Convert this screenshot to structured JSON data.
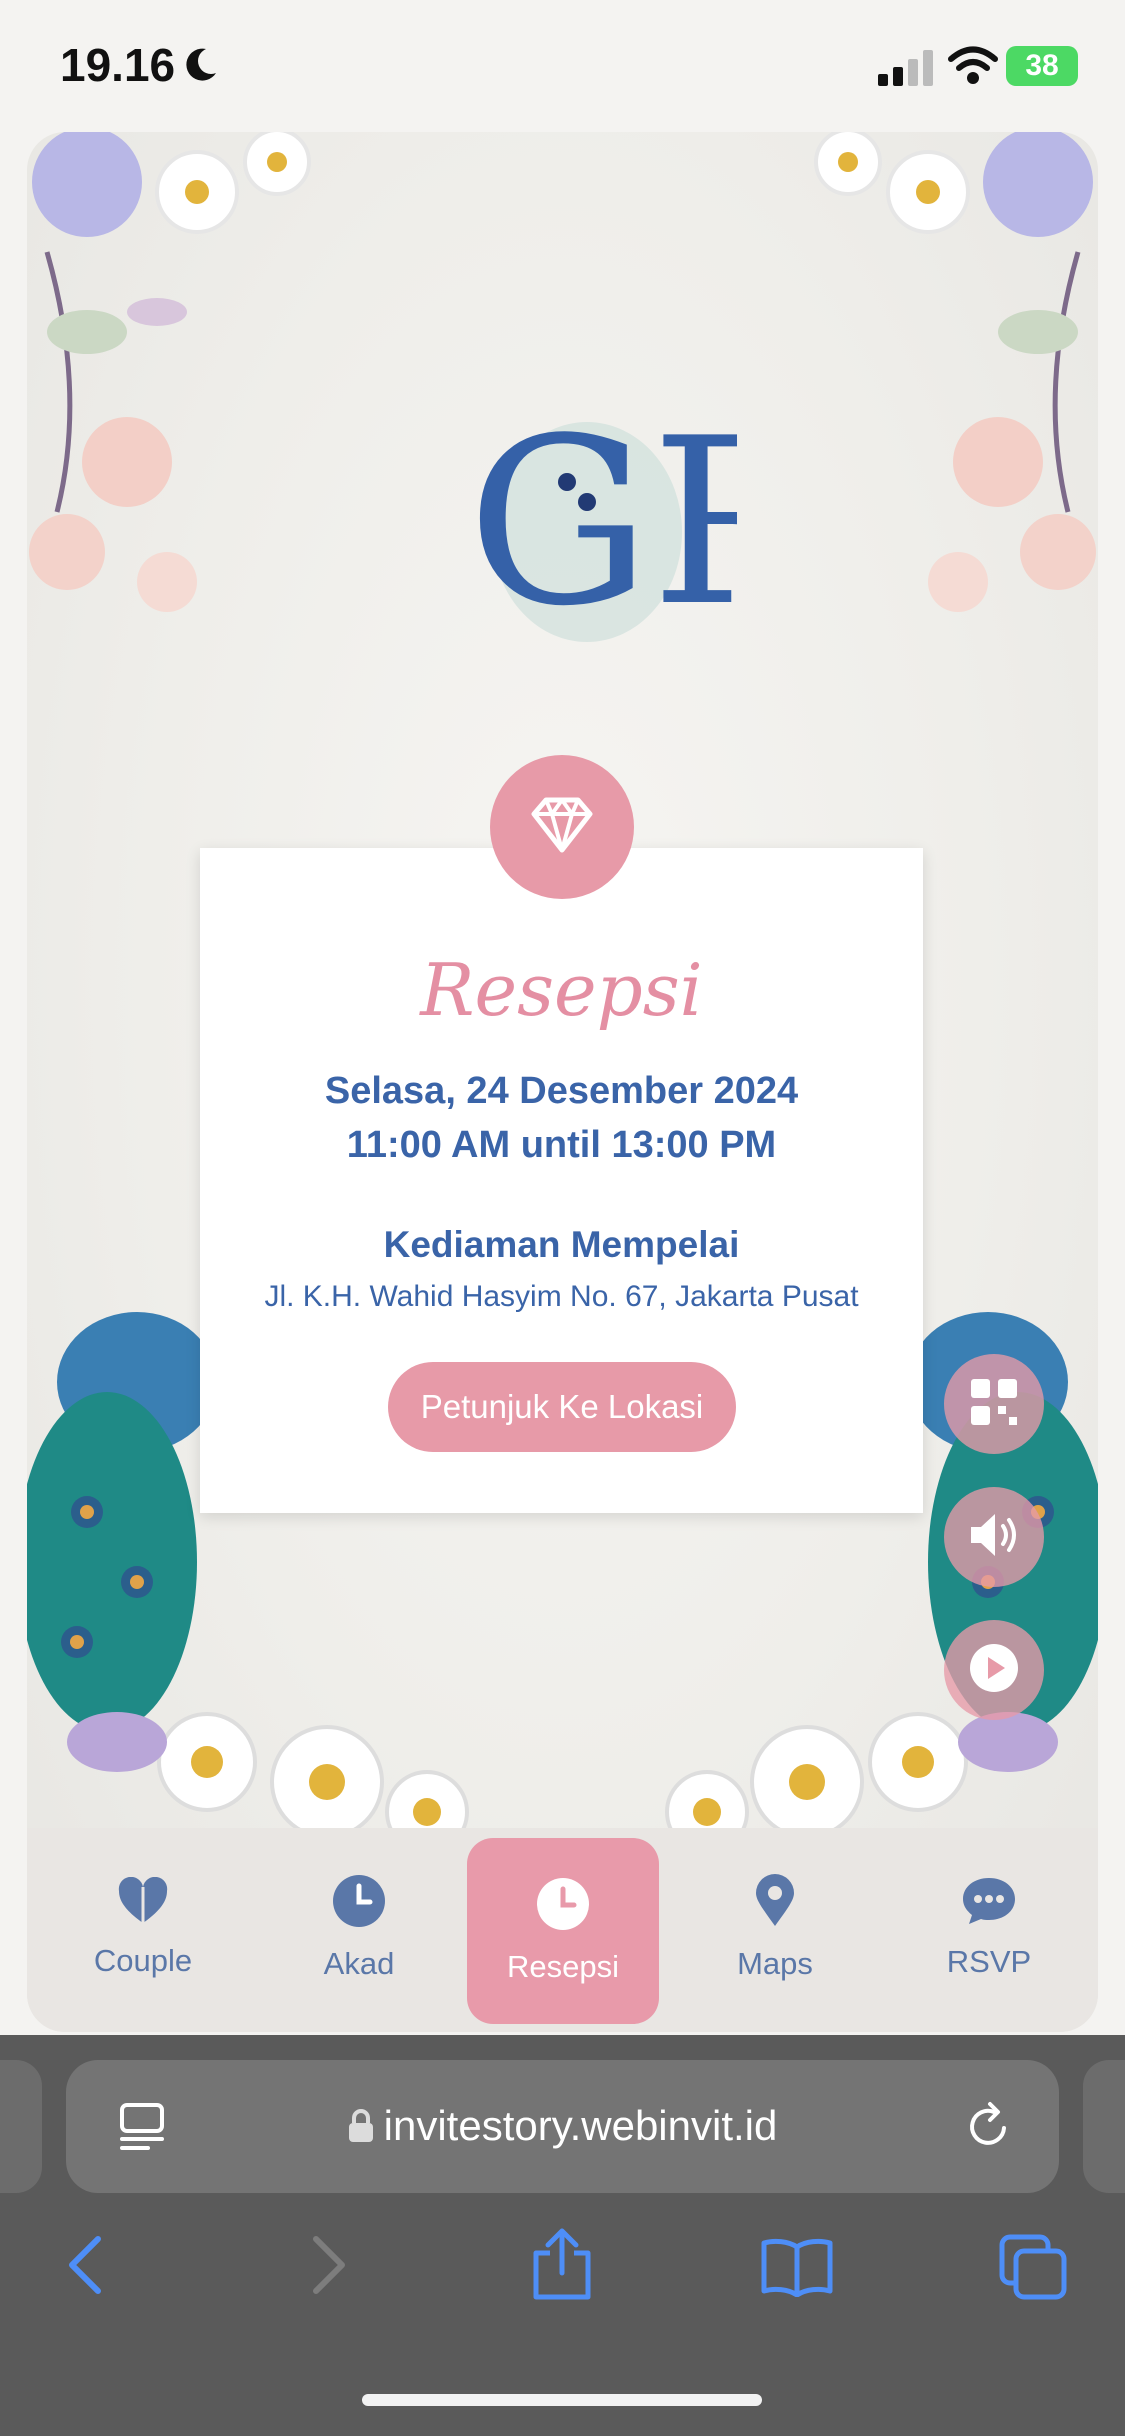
{
  "status_bar": {
    "time": "19.16",
    "battery": "38"
  },
  "invitation": {
    "monogram": "GR",
    "event": {
      "title": "Resepsi",
      "date": "Selasa, 24 Desember 2024",
      "time": "11:00 AM until 13:00 PM",
      "venue_name": "Kediaman Mempelai",
      "venue_address": "Jl. K.H. Wahid Hasyim No. 67, Jakarta Pusat",
      "direction_button": "Petunjuk Ke Lokasi"
    }
  },
  "bottom_nav": {
    "items": [
      {
        "label": "Couple",
        "icon": "heart-icon"
      },
      {
        "label": "Akad",
        "icon": "clock-icon"
      },
      {
        "label": "Resepsi",
        "icon": "clock-icon",
        "active": true
      },
      {
        "label": "Maps",
        "icon": "map-pin-icon"
      },
      {
        "label": "RSVP",
        "icon": "chat-bubble-icon"
      }
    ]
  },
  "browser": {
    "url": "invitestory.webinvit.id"
  },
  "colors": {
    "accent_pink": "#e79aa8",
    "text_blue": "#3a64a8"
  }
}
